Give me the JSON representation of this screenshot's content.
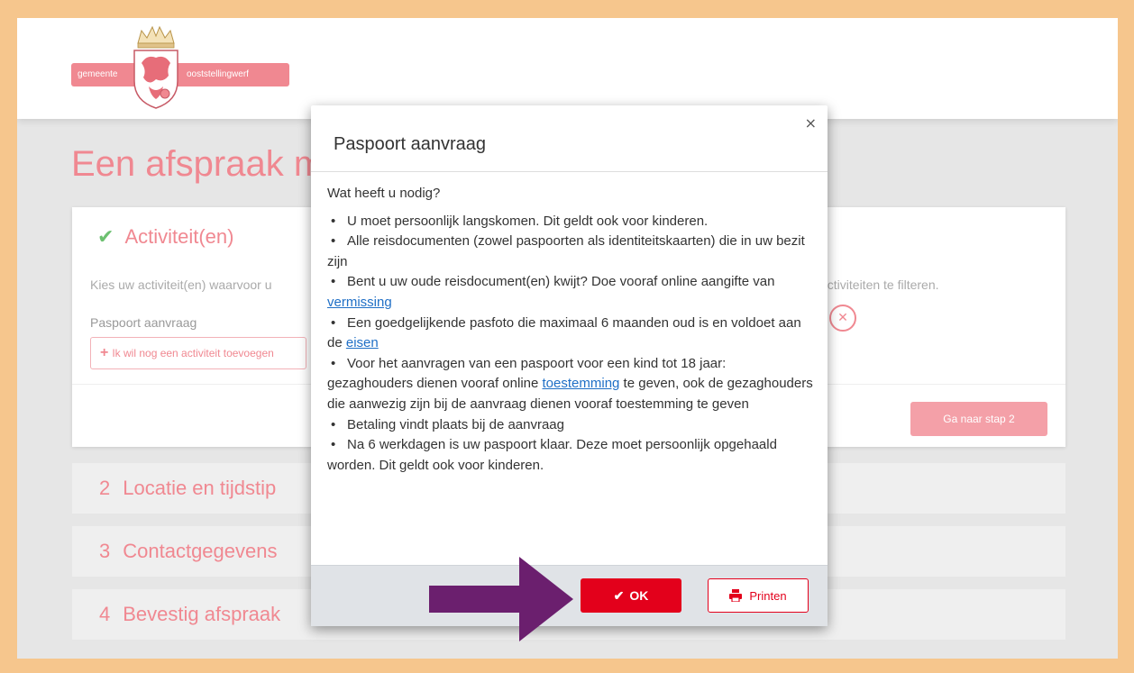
{
  "header": {
    "logo_left_text": "gemeente",
    "logo_right_text": "ooststellingwerf"
  },
  "page": {
    "title": "Een afspraak m"
  },
  "step1": {
    "title": "Activiteit(en)",
    "description_left": "Kies uw activiteit(en) waarvoor u",
    "description_right": "activiteiten te filteren.",
    "selected_activity": "Paspoort aanvraag",
    "add_button": "Ik wil nog een activiteit toevoegen",
    "next_button": "Ga naar stap 2"
  },
  "steps": [
    {
      "num": "2",
      "label": "Locatie en tijdstip"
    },
    {
      "num": "3",
      "label": "Contactgegevens"
    },
    {
      "num": "4",
      "label": "Bevestig afspraak"
    }
  ],
  "modal": {
    "close": "×",
    "title": "Paspoort aanvraag",
    "intro": "Wat heeft u nodig?",
    "items": {
      "i1": "U moet persoonlijk langskomen. Dit geldt ook voor kinderen.",
      "i2": "Alle reisdocumenten (zowel paspoorten als identiteitskaarten) die in uw bezit zijn",
      "i3_pre": "Bent u uw oude reisdocument(en) kwijt? Doe vooraf  online aangifte van ",
      "i3_link": "vermissing",
      "i4_pre": "Een goedgelijkende pasfoto die maximaal 6 maanden oud is en voldoet aan de ",
      "i4_link": "eisen",
      "i5_pre": "Voor het aanvragen van een paspoort voor een kind tot 18 jaar: gezaghouders dienen  vooraf online ",
      "i5_link": "toestemming",
      "i5_post": " te geven, ook de gezaghouders die aanwezig zijn bij de aanvraag dienen vooraf toestemming te geven",
      "i6": "Betaling vindt plaats bij de aanvraag",
      "i7": "Na 6 werkdagen is uw paspoort klaar. Deze moet persoonlijk opgehaald worden. Dit geldt ook voor kinderen."
    },
    "ok_button": "OK",
    "print_button": "Printen"
  },
  "colors": {
    "brand_pink": "#f08891",
    "primary_red": "#e3001b",
    "border_orange": "#f6c68d",
    "arrow_purple": "#6b1f6e"
  },
  "icons": {
    "check": "check-icon",
    "plus": "plus-icon",
    "remove": "remove-icon",
    "close": "close-icon",
    "printer": "printer-icon"
  }
}
